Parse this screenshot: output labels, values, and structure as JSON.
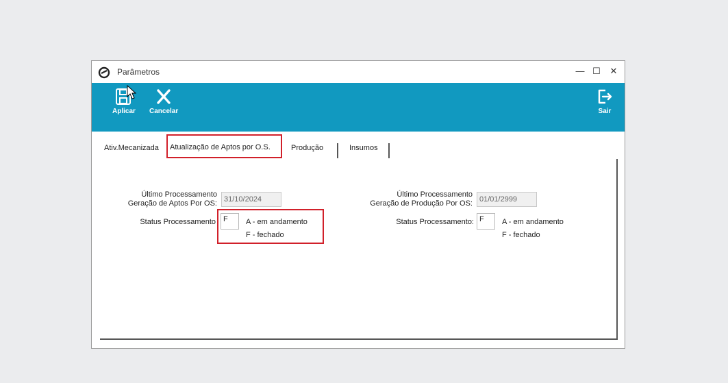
{
  "window": {
    "title": "Parâmetros",
    "minimize": "—",
    "maximize": "☐",
    "close": "✕"
  },
  "toolbar": {
    "apply_label": "Aplicar",
    "cancel_label": "Cancelar",
    "exit_label": "Sair"
  },
  "tabs": [
    {
      "label": "Ativ.Mecanizada"
    },
    {
      "label": "Atualização de Aptos por O.S."
    },
    {
      "label": "Produção"
    },
    {
      "label": "Insumos"
    }
  ],
  "left": {
    "last_process_label_1": "Último Processamento",
    "last_process_label_2": "Geração de Aptos Por OS:",
    "last_process_value": "31/10/2024",
    "status_label": "Status Processamento",
    "status_value": "F",
    "option_a": "A - em andamento",
    "option_f": "F - fechado"
  },
  "right": {
    "last_process_label_1": "Último Processamento",
    "last_process_label_2": "Geração de Produção Por OS:",
    "last_process_value": "01/01/2999",
    "status_label": "Status Processamento:",
    "status_value": "F",
    "option_a": "A - em andamento",
    "option_f": "F - fechado"
  },
  "colors": {
    "toolbar": "#1199c0",
    "highlight": "#d1202a",
    "background": "#ebecee"
  }
}
